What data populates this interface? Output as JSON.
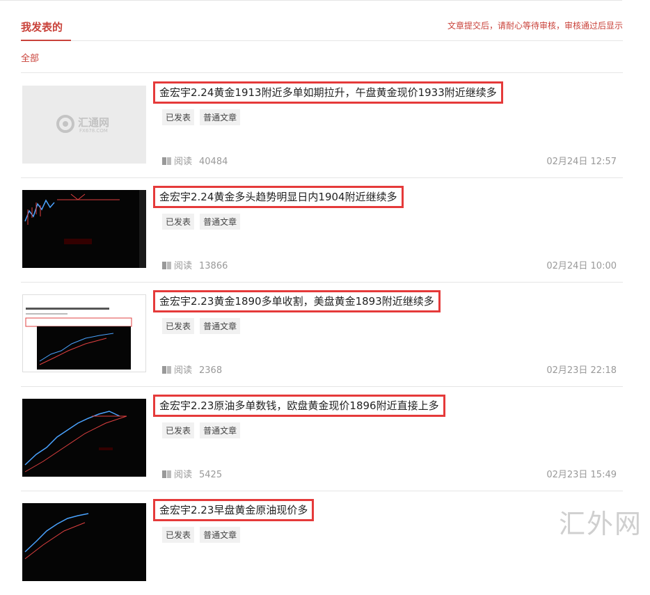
{
  "header": {
    "title": "我发表的",
    "notice": "文章提交后，请耐心等待审核，审核通过后显示"
  },
  "filter": {
    "all_label": "全部"
  },
  "articles": [
    {
      "title": "金宏宇2.24黄金1913附近多单如期拉升，午盘黄金现价1933附近继续多",
      "tags": [
        "已发表",
        "普通文章"
      ],
      "read_label": "阅读",
      "reads": "40484",
      "date": "02月24日 12:57",
      "thumb": {
        "logo_text": "汇通网",
        "logo_sub": "FX678.COM"
      }
    },
    {
      "title": "金宏宇2.24黄金多头趋势明显日内1904附近继续多",
      "tags": [
        "已发表",
        "普通文章"
      ],
      "read_label": "阅读",
      "reads": "13866",
      "date": "02月24日 10:00"
    },
    {
      "title": "金宏宇2.23黄金1890多单收割，美盘黄金1893附近继续多",
      "tags": [
        "已发表",
        "普通文章"
      ],
      "read_label": "阅读",
      "reads": "2368",
      "date": "02月23日 22:18"
    },
    {
      "title": "金宏宇2.23原油多单数钱，欧盘黄金现价1896附近直接上多",
      "tags": [
        "已发表",
        "普通文章"
      ],
      "read_label": "阅读",
      "reads": "5425",
      "date": "02月23日 15:49"
    },
    {
      "title": "金宏宇2.23早盘黄金原油现价多",
      "tags": [
        "已发表",
        "普通文章"
      ]
    }
  ],
  "watermark": "汇外网",
  "colors": {
    "accent": "#c9423a",
    "highlight_box": "#e53a3a"
  }
}
